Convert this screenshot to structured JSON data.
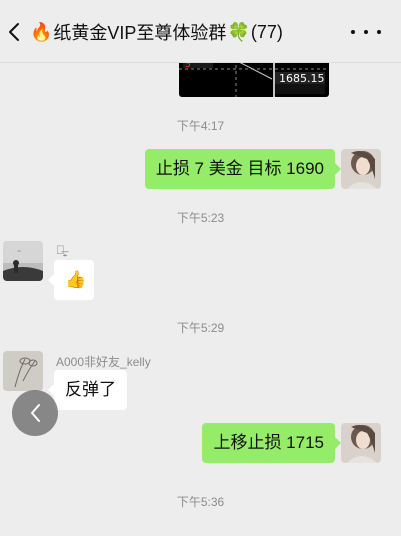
{
  "header": {
    "fire_emoji": "🔥",
    "title": "纸黄金VIP至尊体验群",
    "clover_emoji": "🍀",
    "member_count": "(77)"
  },
  "chart_image": {
    "price_label": "1685.15",
    "red_label": "5"
  },
  "messages": [
    {
      "type": "time",
      "text": "下午4:17"
    },
    {
      "type": "out",
      "text": "止损 7 美金 目标 1690"
    },
    {
      "type": "time",
      "text": "下午5:23"
    },
    {
      "type": "in",
      "sender": "俗̶̜̠̞",
      "emoji": "👍"
    },
    {
      "type": "time",
      "text": "下午5:29"
    },
    {
      "type": "in",
      "sender": "A000非好友_kelly",
      "text": "反弹了"
    },
    {
      "type": "out",
      "text": "上移止损 1715"
    },
    {
      "type": "time",
      "text": "下午5:36"
    }
  ],
  "colors": {
    "bubble_out": "#95ec69",
    "bubble_in": "#ffffff",
    "background": "#ededed"
  }
}
